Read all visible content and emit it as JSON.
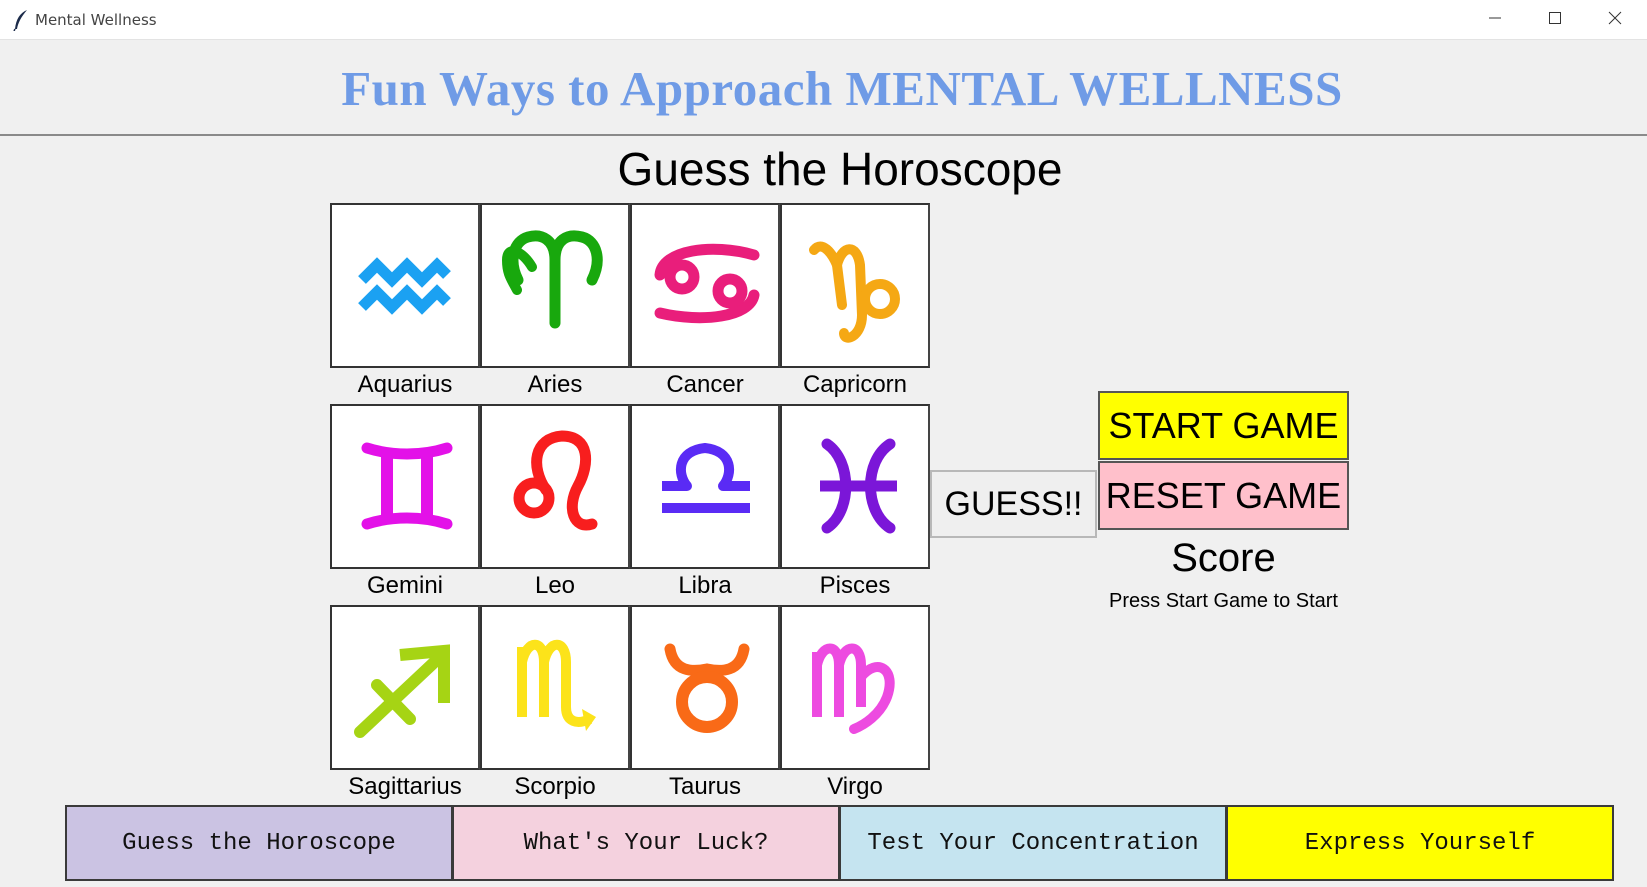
{
  "window": {
    "title": "Mental Wellness",
    "controls": {
      "minimize": "minimize-icon",
      "maximize": "maximize-icon",
      "close": "close-icon"
    }
  },
  "header": {
    "title": "Fun Ways to Approach MENTAL WELLNESS",
    "title_color": "#6f9be6"
  },
  "game": {
    "title": "Guess the Horoscope",
    "signs": [
      {
        "label": "Aquarius",
        "color": "#1ba1f2",
        "icon": "aquarius-icon"
      },
      {
        "label": "Aries",
        "color": "#18a80d",
        "icon": "aries-icon"
      },
      {
        "label": "Cancer",
        "color": "#e91e7b",
        "icon": "cancer-icon"
      },
      {
        "label": "Capricorn",
        "color": "#f5a814",
        "icon": "capricorn-icon"
      },
      {
        "label": "Gemini",
        "color": "#e311e8",
        "icon": "gemini-icon"
      },
      {
        "label": "Leo",
        "color": "#f81e1e",
        "icon": "leo-icon"
      },
      {
        "label": "Libra",
        "color": "#5a2bf5",
        "icon": "libra-icon"
      },
      {
        "label": "Pisces",
        "color": "#7b16d8",
        "icon": "pisces-icon"
      },
      {
        "label": "Sagittarius",
        "color": "#a6d414",
        "icon": "sagittarius-icon"
      },
      {
        "label": "Scorpio",
        "color": "#fce31a",
        "icon": "scorpio-icon"
      },
      {
        "label": "Taurus",
        "color": "#f96a17",
        "icon": "taurus-icon"
      },
      {
        "label": "Virgo",
        "color": "#ed4be0",
        "icon": "virgo-icon"
      }
    ],
    "guess_label": "GUESS!!",
    "start_label": "START GAME",
    "reset_label": "RESET GAME",
    "score_title": "Score",
    "score_message": "Press Start Game to Start"
  },
  "nav": {
    "items": [
      {
        "label": "Guess the Horoscope",
        "color": "#cbc3e3"
      },
      {
        "label": "What's Your Luck?",
        "color": "#f4d1de"
      },
      {
        "label": "Test Your Concentration",
        "color": "#c5e4f0"
      },
      {
        "label": "Express Yourself",
        "color": "#ffff00"
      }
    ]
  }
}
